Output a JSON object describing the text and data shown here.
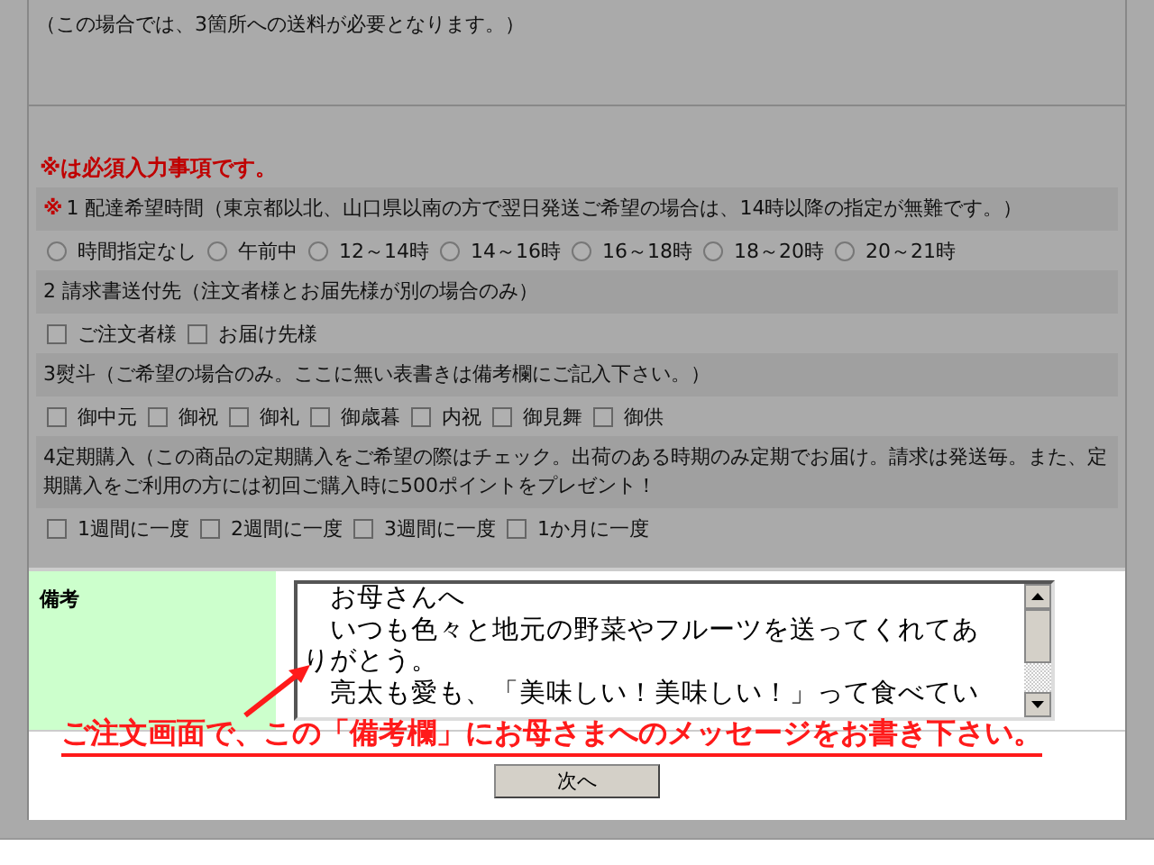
{
  "intro_note": "（この場合では、3箇所への送料が必要となります。）",
  "required_note": "※は必須入力事項です。",
  "sections": [
    {
      "mark": "※",
      "label": "1  配達希望時間（東京都以北、山口県以南の方で翌日発送ご希望の場合は、14時以降の指定が無難です。）",
      "kind": "radio",
      "options": [
        {
          "label": "時間指定なし",
          "selected": false
        },
        {
          "label": "午前中",
          "selected": false
        },
        {
          "label": "12～14時",
          "selected": false
        },
        {
          "label": "14～16時",
          "selected": false
        },
        {
          "label": "16～18時",
          "selected": false
        },
        {
          "label": "18～20時",
          "selected": false
        },
        {
          "label": "20～21時",
          "selected": false
        }
      ]
    },
    {
      "label": "2  請求書送付先（注文者様とお届先様が別の場合のみ）",
      "kind": "checkbox",
      "options": [
        {
          "label": "ご注文者様",
          "checked": false
        },
        {
          "label": "お届け先様",
          "checked": false
        }
      ]
    },
    {
      "label": "3熨斗（ご希望の場合のみ。ここに無い表書きは備考欄にご記入下さい。）",
      "kind": "checkbox",
      "options": [
        {
          "label": "御中元",
          "checked": false
        },
        {
          "label": "御祝",
          "checked": false
        },
        {
          "label": "御礼",
          "checked": false
        },
        {
          "label": "御歳暮",
          "checked": false
        },
        {
          "label": "内祝",
          "checked": false
        },
        {
          "label": "御見舞",
          "checked": false
        },
        {
          "label": "御供",
          "checked": false
        }
      ]
    },
    {
      "label": "4定期購入（この商品の定期購入をご希望の際はチェック。出荷のある時期のみ定期でお届け。請求は発送毎。また、定期購入をご利用の方には初回ご購入時に500ポイントをプレゼント！",
      "kind": "checkbox",
      "options": [
        {
          "label": "1週間に一度",
          "checked": false
        },
        {
          "label": "2週間に一度",
          "checked": false
        },
        {
          "label": "3週間に一度",
          "checked": false
        },
        {
          "label": "1か月に一度",
          "checked": false
        }
      ]
    }
  ],
  "remarks": {
    "label": "備考",
    "lines": [
      "　お母さんへ",
      "　いつも色々と地元の野菜やフルーツを送ってくれてあ",
      "りがとう。",
      "　亮太も愛も、「美味しい！美味しい！」って食べてい"
    ]
  },
  "annotation": "ご注文画面で、この「備考欄」にお母さまへのメッセージをお書き下さい。",
  "next_button": "次へ"
}
